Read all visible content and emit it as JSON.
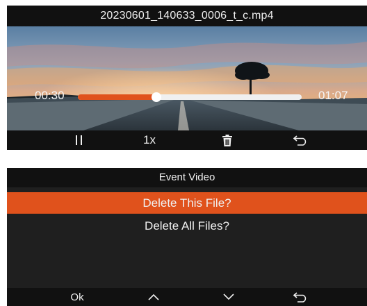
{
  "player": {
    "filename": "20230601_140633_0006_t_c.mp4",
    "current_time": "00:30",
    "total_time": "01:07",
    "progress_fraction": 0.35,
    "speed_label": "1x",
    "icons": [
      "pause-icon",
      "trash-icon",
      "back-icon"
    ]
  },
  "menu": {
    "title": "Event Video",
    "items": [
      {
        "label": "Delete This File?",
        "selected": true
      },
      {
        "label": "Delete All Files?",
        "selected": false
      }
    ],
    "ok_label": "Ok",
    "icons": [
      "chevron-up-icon",
      "chevron-down-icon",
      "back-icon"
    ]
  },
  "colors": {
    "accent": "#e0521c",
    "bar_bg": "#111111",
    "panel_bg": "#1f1f1f"
  }
}
